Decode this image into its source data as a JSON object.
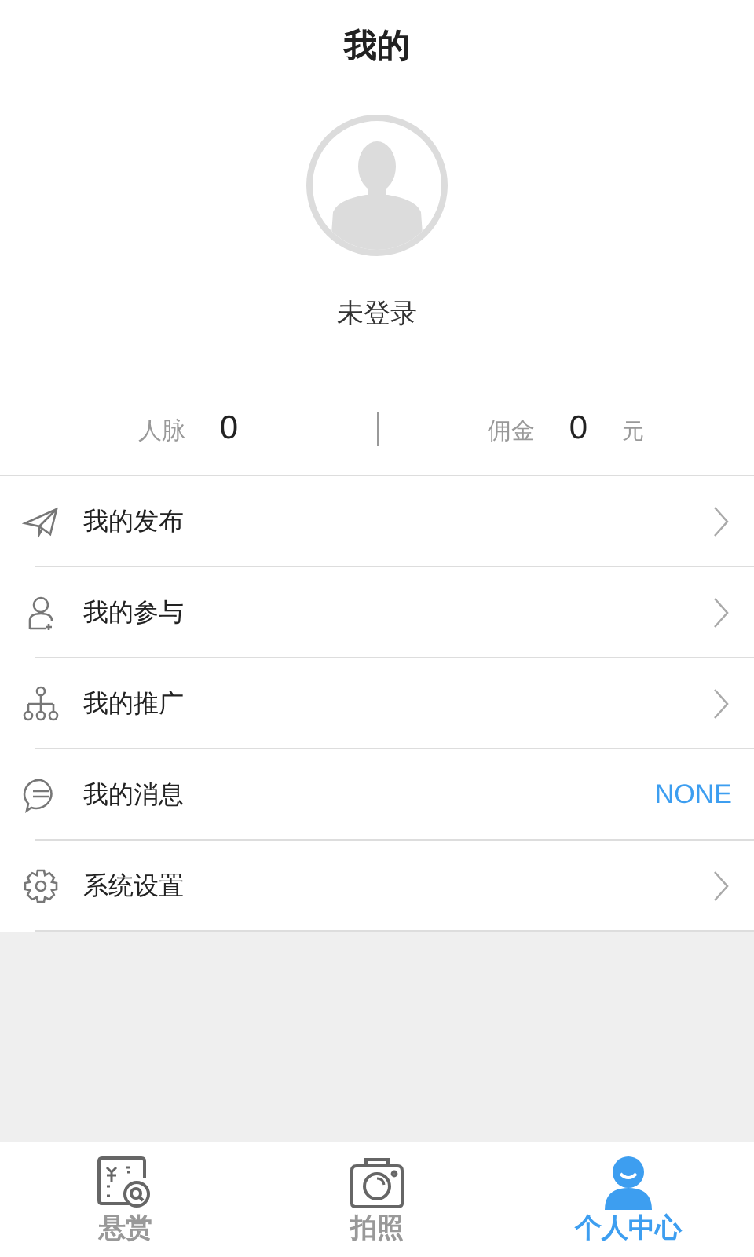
{
  "header": {
    "title": "我的"
  },
  "profile": {
    "name": "未登录"
  },
  "stats": [
    {
      "label": "人脉",
      "value": "0"
    },
    {
      "label": "佣金",
      "value": "0",
      "unit": "元"
    }
  ],
  "menu": [
    {
      "kind": "link",
      "label": "我的发布"
    },
    {
      "kind": "link",
      "label": "我的参与"
    },
    {
      "kind": "link",
      "label": "我的推广"
    },
    {
      "kind": "value",
      "label": "我的消息",
      "value": "NONE"
    },
    {
      "kind": "link",
      "label": "系统设置"
    }
  ],
  "tabs": [
    {
      "label": "悬赏",
      "selected": false
    },
    {
      "label": "拍照",
      "selected": false
    },
    {
      "label": "个人中心",
      "selected": true
    }
  ]
}
